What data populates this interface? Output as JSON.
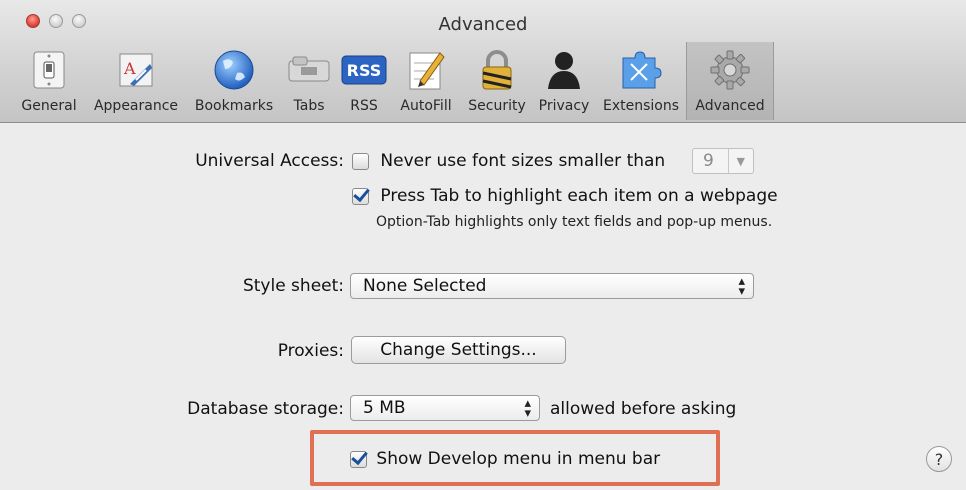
{
  "window": {
    "title": "Advanced"
  },
  "toolbar": {
    "items": [
      {
        "label": "General",
        "icon": "light-switch-icon"
      },
      {
        "label": "Appearance",
        "icon": "font-palette-icon"
      },
      {
        "label": "Bookmarks",
        "icon": "globe-icon"
      },
      {
        "label": "Tabs",
        "icon": "tabs-icon"
      },
      {
        "label": "RSS",
        "icon": "rss-icon"
      },
      {
        "label": "AutoFill",
        "icon": "pencil-form-icon"
      },
      {
        "label": "Security",
        "icon": "padlock-icon"
      },
      {
        "label": "Privacy",
        "icon": "person-silhouette-icon"
      },
      {
        "label": "Extensions",
        "icon": "puzzle-icon"
      },
      {
        "label": "Advanced",
        "icon": "gear-icon"
      }
    ],
    "selected": "Advanced",
    "rss_badge": "RSS"
  },
  "universal_access": {
    "label": "Universal Access:",
    "min_font_checkbox": {
      "label": "Never use font sizes smaller than",
      "checked": false
    },
    "min_font_value": "9",
    "tab_checkbox": {
      "label": "Press Tab to highlight each item on a webpage",
      "checked": true
    },
    "tab_hint": "Option-Tab highlights only text fields and pop-up menus."
  },
  "style_sheet": {
    "label": "Style sheet:",
    "value": "None Selected"
  },
  "proxies": {
    "label": "Proxies:",
    "button": "Change Settings..."
  },
  "database_storage": {
    "label": "Database storage:",
    "value": "5 MB",
    "suffix": "allowed before asking"
  },
  "develop_menu": {
    "label": "Show Develop menu in menu bar",
    "checked": true
  },
  "help": {
    "glyph": "?"
  },
  "colors": {
    "highlight_border": "#e07053",
    "check_color": "#1c4f9c"
  }
}
